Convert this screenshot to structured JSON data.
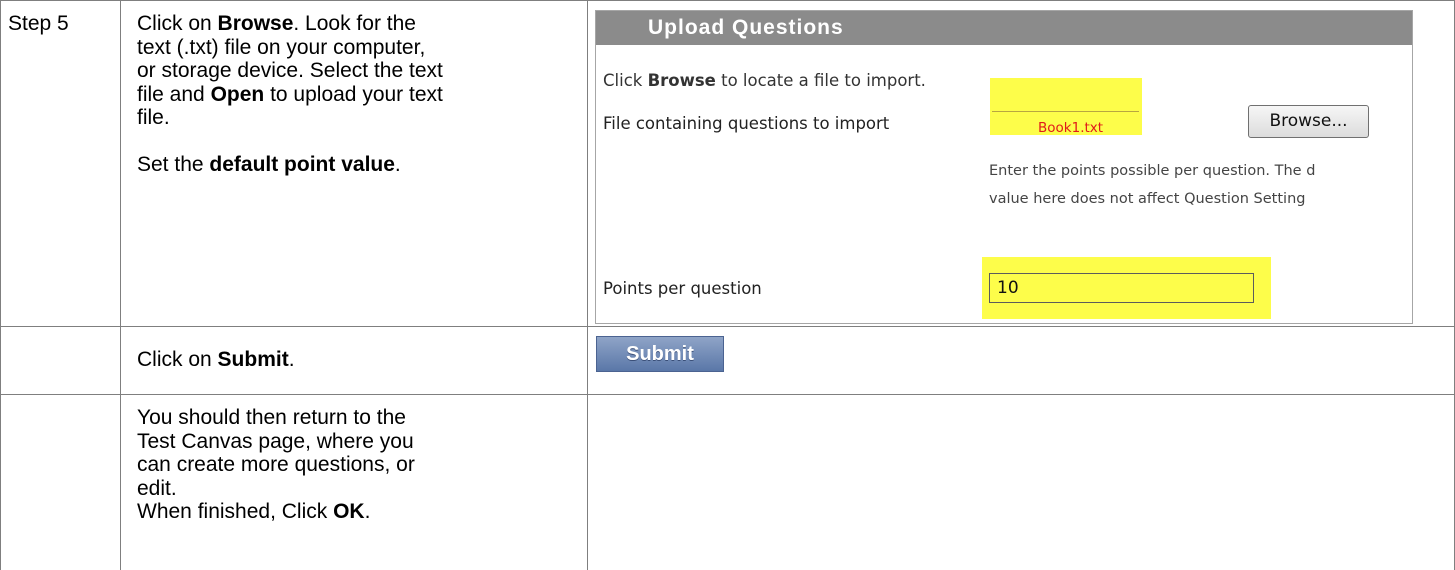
{
  "rows": [
    {
      "step": "Step 5",
      "lines": [
        [
          "Click on ",
          {
            "b": "Browse"
          },
          ". Look for the"
        ],
        [
          "text (.txt) file on your computer,"
        ],
        [
          "or storage device. Select the text"
        ],
        [
          "file and ",
          {
            "b": "Open"
          },
          " to upload your text"
        ],
        [
          "file."
        ],
        [
          ""
        ],
        [
          "Set the ",
          {
            "b": "default point value"
          },
          "."
        ]
      ]
    },
    {
      "step": "",
      "lines": [
        [
          "Click on ",
          {
            "b": "Submit"
          },
          "."
        ]
      ]
    },
    {
      "step": "",
      "lines": [
        [
          "You should then return to the"
        ],
        [
          "Test Canvas page, where you"
        ],
        [
          "can create more questions, or"
        ],
        [
          "edit."
        ],
        [
          "When finished, Click ",
          {
            "b": "OK"
          },
          "."
        ]
      ]
    }
  ],
  "upload_panel": {
    "title": "Upload Questions",
    "instruction_pre": "Click ",
    "instruction_bold": "Browse",
    "instruction_post": " to locate a file to import.",
    "file_label": "File containing questions to import",
    "file_value": "Book1.txt",
    "browse_label": "Browse...",
    "hint_line1": "Enter the points possible per question. The d",
    "hint_line2": "value here does not affect Question Setting",
    "points_label": "Points per question",
    "points_value": "10",
    "highlight_color": "#fdfd4a"
  },
  "submit_label": "Submit"
}
